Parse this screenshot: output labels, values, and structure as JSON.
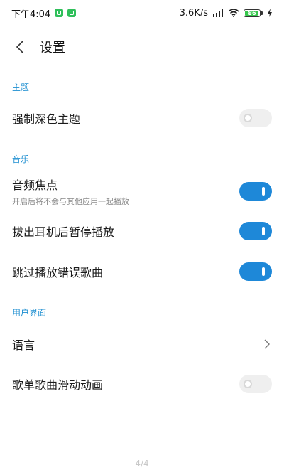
{
  "status_bar": {
    "time": "下午4:04",
    "speed": "3.6K/s",
    "battery": "86"
  },
  "header": {
    "title": "设置"
  },
  "sections": {
    "theme": {
      "title": "主题",
      "force_dark_label": "强制深色主题",
      "force_dark_on": false
    },
    "music": {
      "title": "音乐",
      "audio_focus_label": "音频焦点",
      "audio_focus_sub": "开启后将不会与其他应用一起播放",
      "audio_focus_on": true,
      "pause_on_unplug_label": "拔出耳机后暂停播放",
      "pause_on_unplug_on": true,
      "skip_error_label": "跳过播放错误歌曲",
      "skip_error_on": true
    },
    "ui": {
      "title": "用户界面",
      "language_label": "语言",
      "playlist_anim_label": "歌单歌曲滑动动画",
      "playlist_anim_on": false
    }
  },
  "footer": {
    "page_indicator": "4/4"
  },
  "colors": {
    "accent": "#1e88d8",
    "section_title": "#1f8fd1",
    "toggle_off": "#efefef"
  }
}
